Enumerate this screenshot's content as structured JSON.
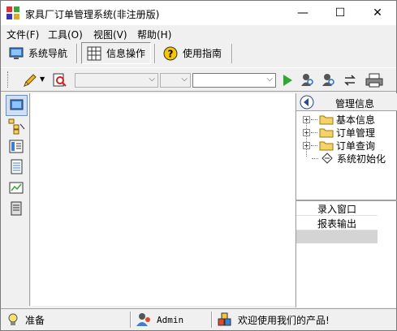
{
  "window": {
    "title": "家具厂订单管理系统(非注册版)",
    "controls": {
      "minimize": "—",
      "maximize": "☐",
      "close": "✕"
    }
  },
  "menu": [
    "文件(F)",
    "工具(O)",
    "视图(V)",
    "帮助(H)"
  ],
  "nav": {
    "system_nav": "系统导航",
    "info_ops": "信息操作",
    "guide": "使用指南"
  },
  "toolbar": {
    "combo1_value": "",
    "combo2_value": "",
    "combo3_value": ""
  },
  "right_panel": {
    "header": "管理信息",
    "tree": [
      "基本信息",
      "订单管理",
      "订单查询",
      "系统初始化"
    ],
    "list": [
      "录入窗口",
      "报表输出"
    ]
  },
  "status": {
    "ready": "准备",
    "user": "Admin",
    "welcome": "欢迎使用我们的产品!"
  },
  "colors": {
    "active_highlight": "#cde0f7",
    "folder": "#f5d36b",
    "play_green": "#2fa82f"
  }
}
